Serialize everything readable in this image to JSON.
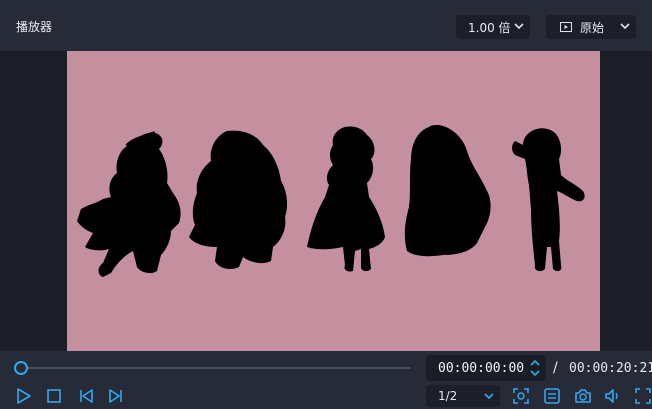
{
  "window": {
    "title": "播放器"
  },
  "toolbar": {
    "speed": "1.00 倍",
    "aspect": "原始"
  },
  "player": {
    "current_time": "00:00:00:00",
    "separator": "/",
    "total_time": "00:00:20:21",
    "progress": 0.0,
    "page": "1/2"
  },
  "colors": {
    "accent": "#30a9f0",
    "video_background": "#c490a0",
    "panel": "#272b37",
    "stage": "#1b1e26"
  },
  "icons": {
    "play": "play-icon",
    "stop": "stop-icon",
    "prev": "skip-previous-icon",
    "next": "skip-next-icon",
    "snapshot_area": "screenshot-area-icon",
    "playlist": "list-icon",
    "camera": "camera-icon",
    "volume": "volume-icon",
    "fullscreen": "fullscreen-icon"
  }
}
